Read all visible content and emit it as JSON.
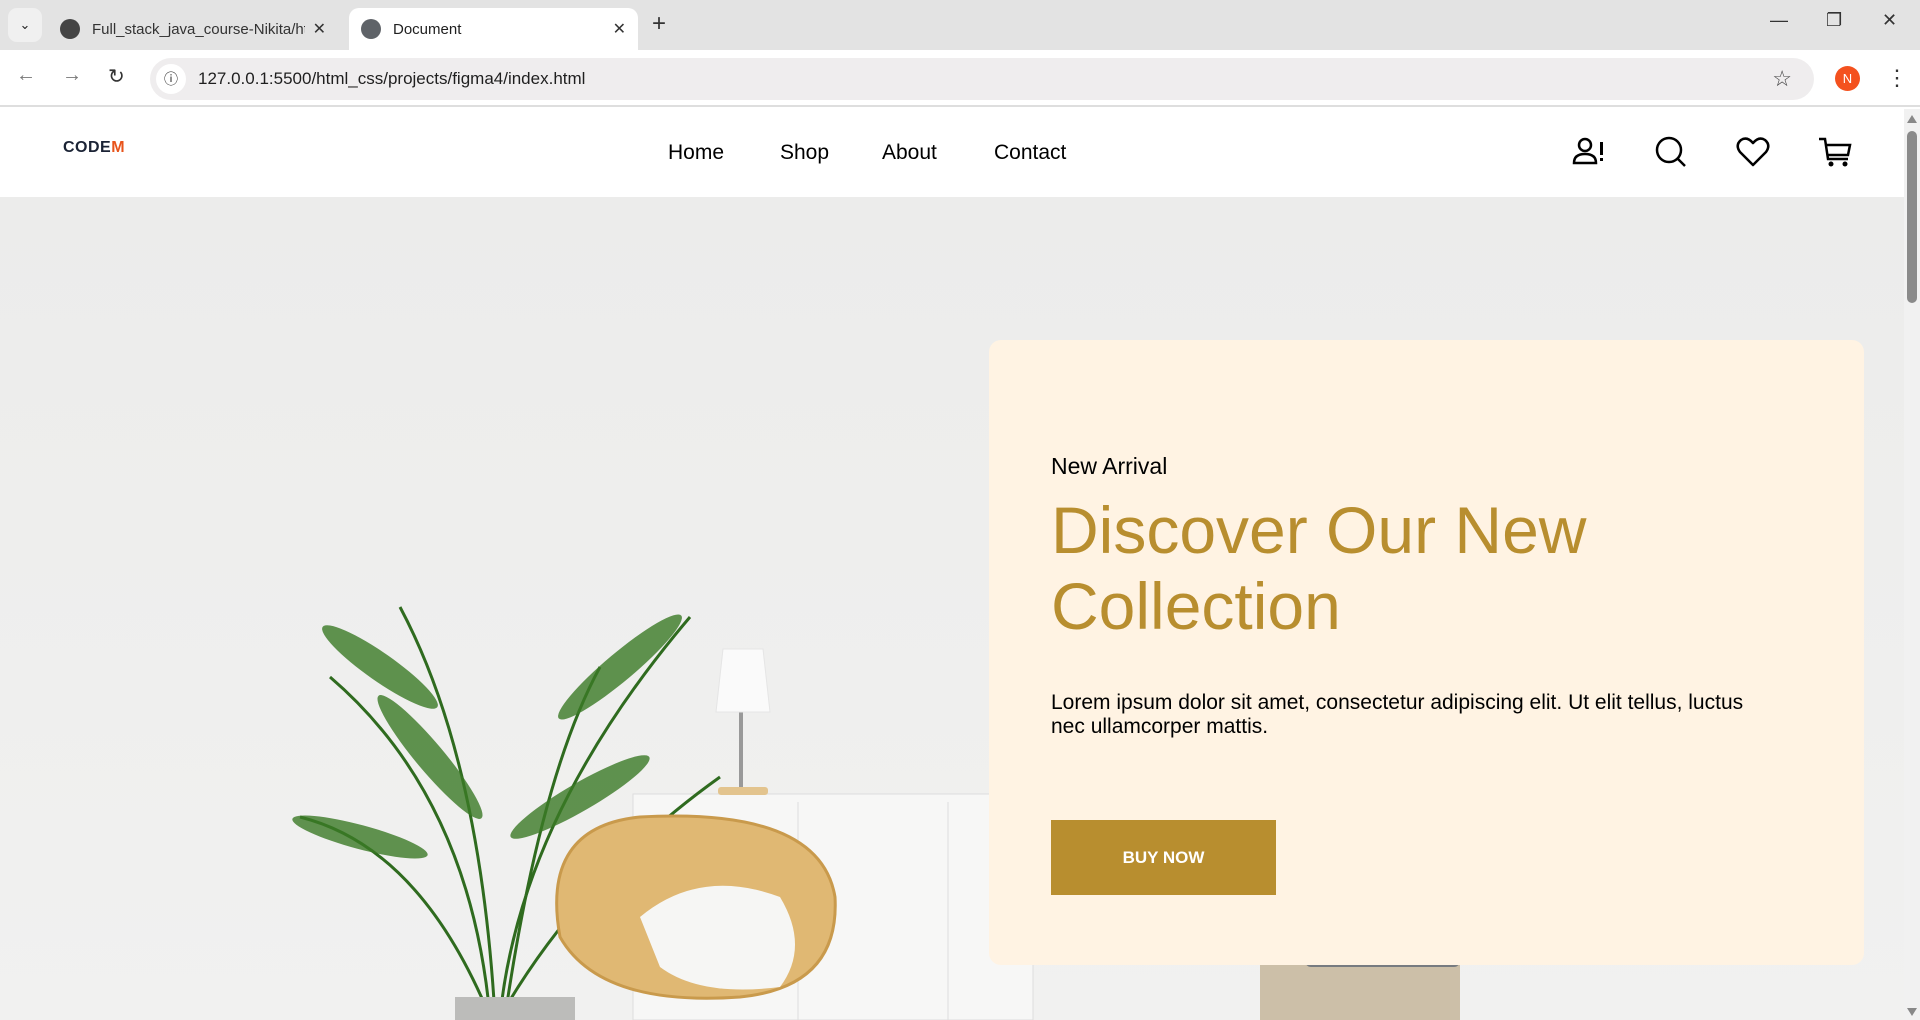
{
  "browser": {
    "tabs": [
      {
        "title": "Full_stack_java_course-Nikita/ht",
        "icon": "github-icon"
      },
      {
        "title": "Document",
        "icon": "globe-icon"
      }
    ],
    "url": "127.0.0.1:5500/html_css/projects/figma4/index.html",
    "profile_initial": "N"
  },
  "site": {
    "logo": {
      "main": "CODE",
      "accent": "M"
    },
    "nav": [
      "Home",
      "Shop",
      "About",
      "Contact"
    ],
    "icons": [
      "user-alert-icon",
      "search-icon",
      "heart-icon",
      "cart-icon"
    ]
  },
  "hero": {
    "kicker": "New Arrival",
    "title": "Discover Our New Collection",
    "description": "Lorem ipsum dolor sit amet, consectetur adipiscing elit. Ut elit tellus, luctus nec ullamcorper mattis.",
    "button": "BUY NOW"
  },
  "colors": {
    "accent": "#b88e2f",
    "card": "#fff3e3",
    "profile": "#f4511e"
  }
}
